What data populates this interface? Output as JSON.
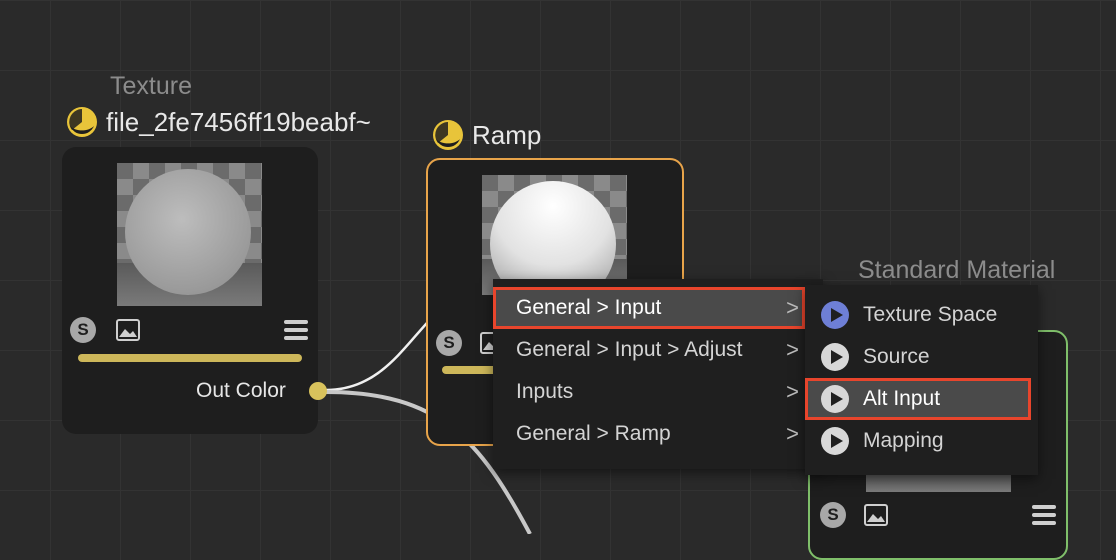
{
  "colors": {
    "canvas_bg": "#2a2a2a",
    "node_bg": "#1e1e1e",
    "selected_node_border": "#e8a44a",
    "material_node_border": "#7fbf6a",
    "port_color": "#d8c25c",
    "highlight_outline": "#e8452c",
    "menu_hover_bg": "#4a4a4a",
    "accent_play": "#6e7fd6"
  },
  "nodes": {
    "texture": {
      "category": "Texture",
      "title": "file_2fe7456ff19beabf~",
      "icon": "yellow-sphere-icon",
      "output_label": "Out Color"
    },
    "ramp": {
      "title": "Ramp",
      "icon": "yellow-sphere-icon"
    },
    "material": {
      "category": "Standard Material"
    }
  },
  "badges": {
    "s_label": "S"
  },
  "context_menu": {
    "items": [
      {
        "label": "General > Input",
        "chevron": ">",
        "selected": true
      },
      {
        "label": "General > Input > Adjust",
        "chevron": ">"
      },
      {
        "label": "Inputs",
        "chevron": ">"
      },
      {
        "label": "General > Ramp",
        "chevron": ">"
      }
    ]
  },
  "submenu": {
    "items": [
      {
        "label": "Texture Space",
        "icon": "play-icon",
        "icon_color": "#6e7fd6"
      },
      {
        "label": "Source",
        "icon": "play-icon",
        "icon_color": "#d8d8d8"
      },
      {
        "label": "Alt Input",
        "icon": "play-icon",
        "icon_color": "#d8d8d8",
        "highlighted": true
      },
      {
        "label": "Mapping",
        "icon": "play-icon",
        "icon_color": "#d8d8d8"
      }
    ]
  }
}
